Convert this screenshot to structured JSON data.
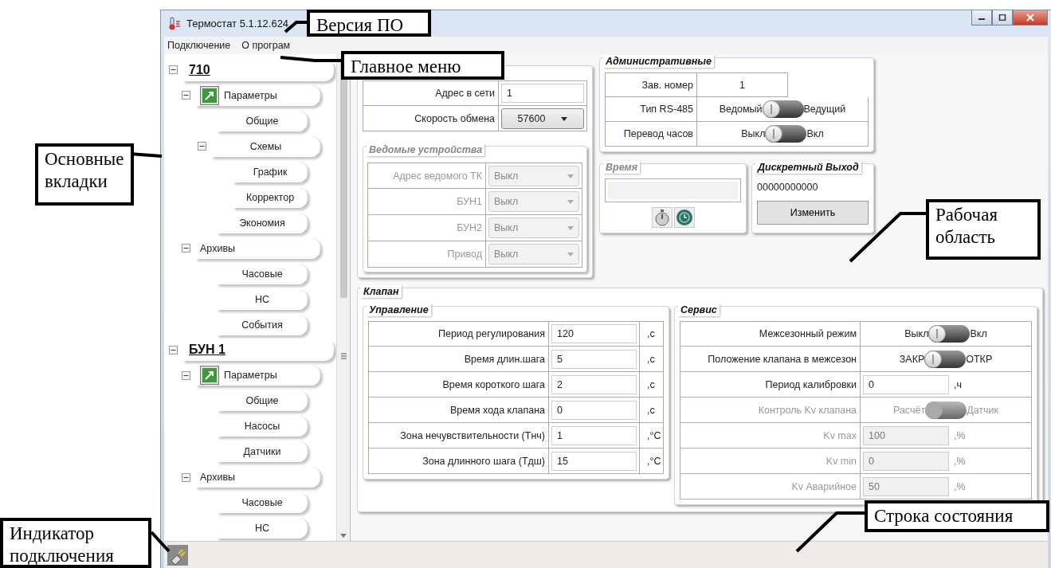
{
  "window": {
    "title": "Термостат 5.1.12.624"
  },
  "menu": [
    {
      "label": "Подключение"
    },
    {
      "label": "О програм"
    }
  ],
  "tree": [
    {
      "label": "710",
      "kind": "device",
      "expanded": true,
      "children": [
        {
          "label": "Параметры",
          "kind": "group",
          "expanded": true,
          "children": [
            {
              "label": "Общие",
              "kind": "page"
            },
            {
              "label": "Схемы",
              "kind": "section",
              "expanded": true,
              "children": [
                {
                  "label": "График",
                  "kind": "page"
                },
                {
                  "label": "Корректор",
                  "kind": "page"
                }
              ]
            },
            {
              "label": "Экономия",
              "kind": "page"
            }
          ]
        },
        {
          "label": "Архивы",
          "kind": "section",
          "expanded": true,
          "children": [
            {
              "label": "Часовые",
              "kind": "page"
            },
            {
              "label": "НС",
              "kind": "page"
            },
            {
              "label": "События",
              "kind": "page"
            }
          ]
        }
      ]
    },
    {
      "label": "БУН 1",
      "kind": "device",
      "expanded": true,
      "children": [
        {
          "label": "Параметры",
          "kind": "group",
          "expanded": true,
          "children": [
            {
              "label": "Общие",
              "kind": "page"
            },
            {
              "label": "Насосы",
              "kind": "page"
            },
            {
              "label": "Датчики",
              "kind": "page"
            }
          ]
        },
        {
          "label": "Архивы",
          "kind": "section",
          "expanded": true,
          "children": [
            {
              "label": "Часовые",
              "kind": "page"
            },
            {
              "label": "НС",
              "kind": "page"
            }
          ]
        }
      ]
    }
  ],
  "network": {
    "rows": [
      {
        "kind": "input",
        "label": "Адрес в сети",
        "value": "1"
      },
      {
        "kind": "select",
        "label": "Скорость обмена",
        "value": "57600"
      }
    ],
    "slaves": {
      "title": "Ведомые устройства",
      "disabled": true,
      "rows": [
        {
          "label": "Адрес ведомого ТК",
          "value": "Выкл"
        },
        {
          "label": "БУН1",
          "value": "Выкл"
        },
        {
          "label": "БУН2",
          "value": "Выкл"
        },
        {
          "label": "Привод",
          "value": "Выкл"
        }
      ]
    }
  },
  "admin": {
    "title": "Административные",
    "rows": [
      {
        "kind": "text",
        "label": "Зав. номер",
        "value": "1"
      },
      {
        "kind": "toggle",
        "label": "Тип RS-485",
        "off_text": "Ведомый",
        "on_text": "Ведущий",
        "on": false
      },
      {
        "kind": "toggle",
        "label": "Перевод часов",
        "off_text": "Выкл",
        "on_text": "Вкл",
        "on": false
      }
    ]
  },
  "time": {
    "title": "Время",
    "disabled": true
  },
  "output": {
    "title": "Дискретный Выход",
    "value": "00000000000",
    "button": "Изменить"
  },
  "valve": {
    "title": "Клапан",
    "control": {
      "title": "Управление",
      "rows": [
        {
          "label": "Период регулирования",
          "value": "120",
          "unit": ",с"
        },
        {
          "label": "Время длин.шага",
          "value": "5",
          "unit": ",с"
        },
        {
          "label": "Время короткого шага",
          "value": "2",
          "unit": ",с"
        },
        {
          "label": "Время хода клапана",
          "value": "0",
          "unit": ",с"
        },
        {
          "label": "Зона нечувствительности (Тнч)",
          "value": "1",
          "unit": ",°С"
        },
        {
          "label": "Зона длинного шага (Тдш)",
          "value": "15",
          "unit": ",°С"
        }
      ]
    },
    "service": {
      "title": "Сервис",
      "rows": [
        {
          "kind": "toggle",
          "label": "Межсезонный режим",
          "off_text": "Выкл",
          "on_text": "Вкл",
          "on": false,
          "disabled": false
        },
        {
          "kind": "toggle",
          "label": "Положение клапана в межсезон",
          "off_text": "ЗАКР",
          "on_text": "ОТКР",
          "on": false,
          "disabled": false
        },
        {
          "kind": "input",
          "label": "Период калибровки",
          "value": "0",
          "unit": ",ч",
          "disabled": false
        },
        {
          "kind": "toggle",
          "label": "Контроль Kv клапана",
          "off_text": "Расчёт",
          "on_text": "Датчик",
          "on": false,
          "disabled": true
        },
        {
          "kind": "input",
          "label": "Kv max",
          "value": "100",
          "unit": ",%",
          "disabled": true
        },
        {
          "kind": "input",
          "label": "Kv min",
          "value": "0",
          "unit": ",%",
          "disabled": true
        },
        {
          "kind": "input",
          "label": "Kv Аварийное",
          "value": "50",
          "unit": ",%",
          "disabled": true
        }
      ]
    }
  },
  "callouts": [
    {
      "text": "Версия ПО"
    },
    {
      "text": "Главное меню"
    },
    {
      "text": "Основные вкладки"
    },
    {
      "text": "Рабочая область"
    },
    {
      "text": "Строка состояния"
    },
    {
      "text": "Индикатор подключения"
    }
  ]
}
